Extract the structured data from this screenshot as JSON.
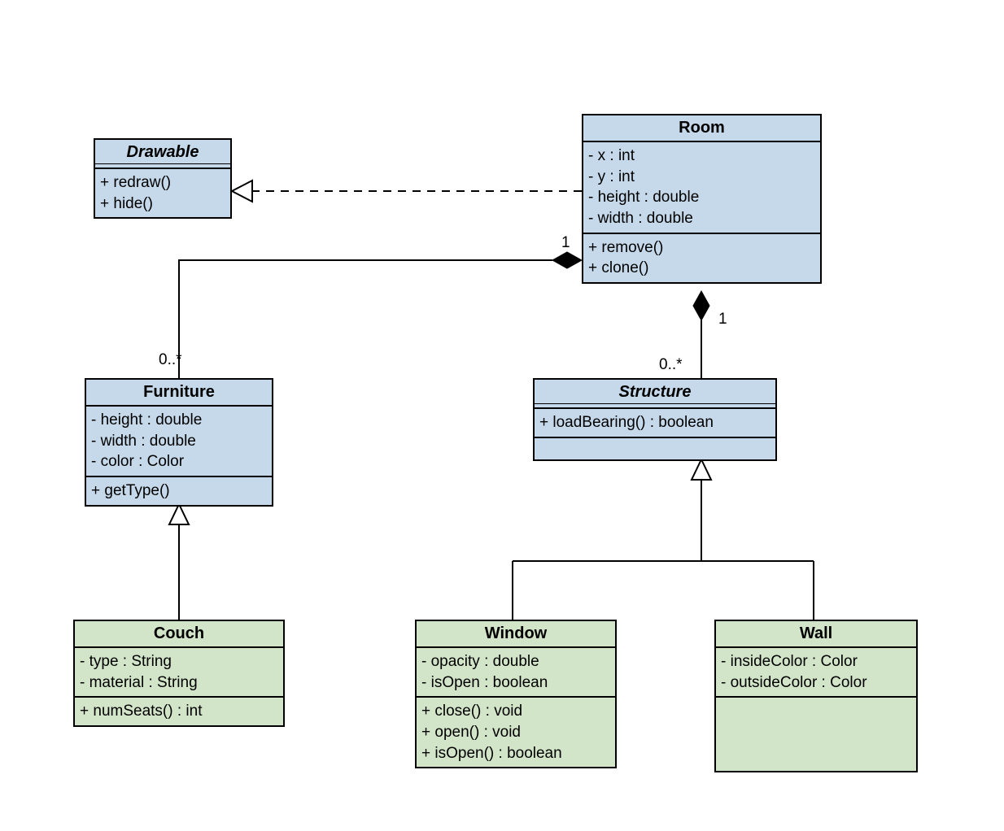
{
  "classes": {
    "drawable": {
      "name": "Drawable",
      "methods": [
        "+ redraw()",
        "+ hide()"
      ]
    },
    "room": {
      "name": "Room",
      "attrs": [
        "- x : int",
        "- y : int",
        "- height : double",
        "- width : double"
      ],
      "methods": [
        "+ remove()",
        "+ clone()"
      ]
    },
    "furniture": {
      "name": "Furniture",
      "attrs": [
        "- height : double",
        "- width : double",
        "- color : Color"
      ],
      "methods": [
        "+ getType()"
      ]
    },
    "structure": {
      "name": "Structure",
      "methods": [
        "+ loadBearing() : boolean"
      ]
    },
    "couch": {
      "name": "Couch",
      "attrs": [
        "- type : String",
        "- material : String"
      ],
      "methods": [
        "+ numSeats() : int"
      ]
    },
    "window": {
      "name": "Window",
      "attrs": [
        "- opacity : double",
        "- isOpen : boolean"
      ],
      "methods": [
        "+ close() : void",
        "+ open() : void",
        "+ isOpen() : boolean"
      ]
    },
    "wall": {
      "name": "Wall",
      "attrs": [
        "- insideColor : Color",
        "- outsideColor : Color"
      ]
    }
  },
  "multiplicities": {
    "room_furniture_room": "1",
    "room_furniture_furn": "0..*",
    "room_structure_room": "1",
    "room_structure_struct": "0..*"
  }
}
